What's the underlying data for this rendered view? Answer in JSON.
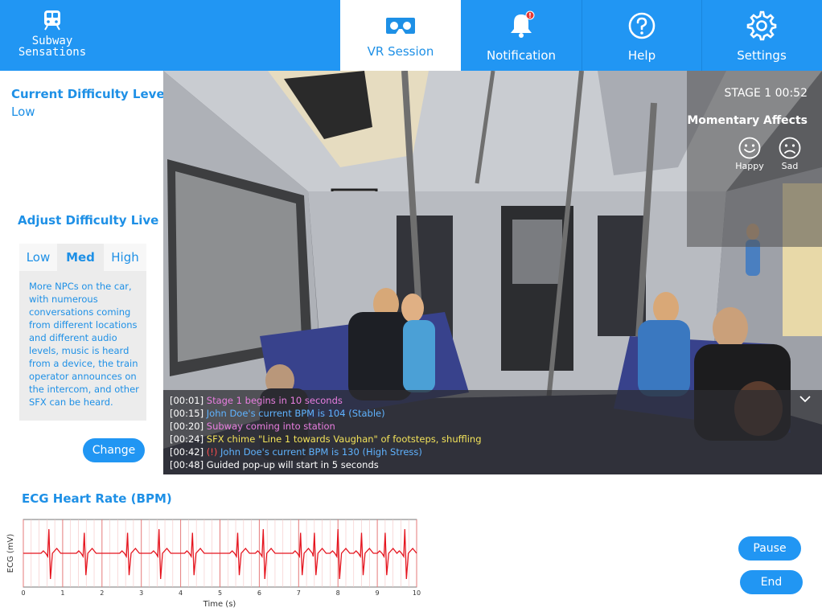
{
  "app": {
    "name_line1": "Subway",
    "name_line2": "Sensations"
  },
  "nav": {
    "tabs": [
      {
        "label": "VR Session",
        "icon": "vr-headset-icon",
        "active": true
      },
      {
        "label": "Notification",
        "icon": "bell-icon",
        "badge": "!"
      },
      {
        "label": "Help",
        "icon": "question-icon"
      },
      {
        "label": "Settings",
        "icon": "gear-icon"
      }
    ]
  },
  "difficulty": {
    "current_title": "Current Difficulty Level",
    "current_value": "Low",
    "adjust_title": "Adjust Difficulty Live",
    "options": [
      "Low",
      "Med",
      "High"
    ],
    "selected": "Med",
    "description": "More NPCs on the car, with numerous conversations coming from different locations and different audio levels, music is heard from a device, the train operator announces on the intercom, and other SFX can be heard.",
    "change_label": "Change"
  },
  "session": {
    "stage": "STAGE 1 00:52",
    "affects_title": "Momentary Affects",
    "affects": [
      {
        "label": "Happy",
        "icon": "happy-face-icon"
      },
      {
        "label": "Sad",
        "icon": "sad-face-icon"
      }
    ],
    "log": [
      {
        "time": "[00:01]",
        "prefix": "",
        "text": "Stage 1 begins in 10 seconds",
        "color": "#e97ee0"
      },
      {
        "time": "[00:15]",
        "prefix": "",
        "text": "John Doe's current BPM is 104 (Stable)",
        "color": "#5fb3ff"
      },
      {
        "time": "[00:20]",
        "prefix": "",
        "text": "Subway coming into station",
        "color": "#e97ee0"
      },
      {
        "time": "[00:24]",
        "prefix": "",
        "text": "SFX chime \"Line 1 towards Vaughan\" of footsteps, shuffling",
        "color": "#f3e35a"
      },
      {
        "time": "[00:42]",
        "prefix": "(!)",
        "text": "John Doe's current BPM is 130 (High Stress)",
        "color": "#5fb3ff"
      },
      {
        "time": "[00:48]",
        "prefix": "",
        "text": "Guided pop-up will start in 5 seconds",
        "color": "#ffffff"
      }
    ],
    "colors": {
      "alert": "#ff4d4d",
      "accent": "#2196f3"
    }
  },
  "ecg": {
    "title": "ECG Heart Rate (BPM)",
    "xlabel": "Time (s)",
    "ylabel": "ECG (mV)",
    "xticks": [
      "0",
      "1",
      "2",
      "3",
      "4",
      "5",
      "6",
      "7",
      "8",
      "9",
      "10"
    ]
  },
  "chart_data": {
    "type": "line",
    "title": "ECG Heart Rate (BPM)",
    "xlabel": "Time (s)",
    "ylabel": "ECG (mV)",
    "xlim": [
      0,
      10
    ],
    "grid": true,
    "x_ticks": [
      0,
      1,
      2,
      3,
      4,
      5,
      6,
      7,
      8,
      9,
      10
    ],
    "beat_times": [
      0.65,
      1.55,
      2.65,
      3.45,
      4.3,
      5.45,
      6.1,
      7.05,
      7.4,
      8.0,
      8.6,
      9.2,
      9.7
    ],
    "series": [
      {
        "color": "#e5141e"
      }
    ]
  },
  "controls": {
    "pause_label": "Pause",
    "end_label": "End"
  }
}
